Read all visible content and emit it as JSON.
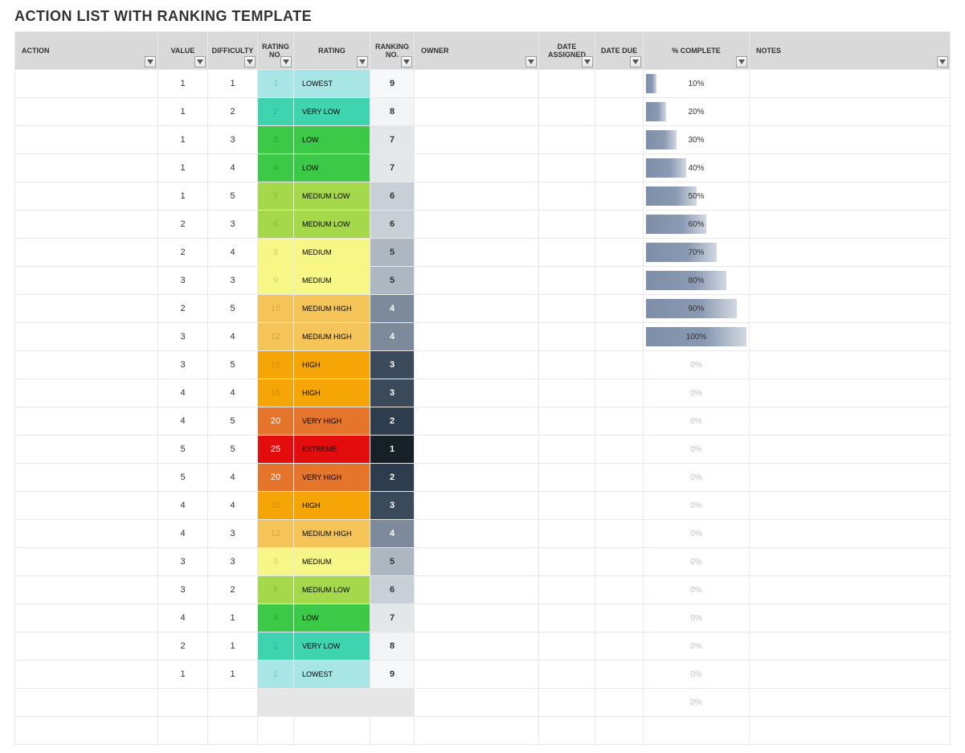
{
  "title": "ACTION LIST WITH RANKING TEMPLATE",
  "columns": {
    "action": "ACTION",
    "value": "VALUE",
    "difficulty": "DIFFICULTY",
    "rating_no": "RATING NO.",
    "rating": "RATING",
    "ranking_no": "RANKING NO.",
    "owner": "OWNER",
    "date_assigned": "DATE ASSIGNED",
    "date_due": "DATE DUE",
    "complete": "% COMPLETE",
    "notes": "NOTES"
  },
  "rows": [
    {
      "value": 1,
      "difficulty": 1,
      "rating_no": 1,
      "rating": "LOWEST",
      "rank_no": 9,
      "rating_no_bg": "#a8e5e5",
      "rating_no_fg": "#7ec9c9",
      "rating_bg": "#a8e5e5",
      "rank_bg": "#f7f8f9",
      "rank_fg": "#333",
      "complete": 10
    },
    {
      "value": 1,
      "difficulty": 2,
      "rating_no": 2,
      "rating": "VERY LOW",
      "rank_no": 8,
      "rating_no_bg": "#3fd4b0",
      "rating_no_fg": "#2cb597",
      "rating_bg": "#3fd4b0",
      "rank_bg": "#f3f4f6",
      "rank_fg": "#333",
      "complete": 20
    },
    {
      "value": 1,
      "difficulty": 3,
      "rating_no": 3,
      "rating": "LOW",
      "rank_no": 7,
      "rating_no_bg": "#3cc948",
      "rating_no_fg": "#2aa835",
      "rating_bg": "#3cc948",
      "rank_bg": "#e4e7ea",
      "rank_fg": "#333",
      "complete": 30
    },
    {
      "value": 1,
      "difficulty": 4,
      "rating_no": 4,
      "rating": "LOW",
      "rank_no": 7,
      "rating_no_bg": "#3cc948",
      "rating_no_fg": "#2aa835",
      "rating_bg": "#3cc948",
      "rank_bg": "#e4e7ea",
      "rank_fg": "#333",
      "complete": 40
    },
    {
      "value": 1,
      "difficulty": 5,
      "rating_no": 5,
      "rating": "MEDIUM LOW",
      "rank_no": 6,
      "rating_no_bg": "#a5d84a",
      "rating_no_fg": "#8abf33",
      "rating_bg": "#a5d84a",
      "rank_bg": "#c9cfd6",
      "rank_fg": "#333",
      "complete": 50
    },
    {
      "value": 2,
      "difficulty": 3,
      "rating_no": 6,
      "rating": "MEDIUM LOW",
      "rank_no": 6,
      "rating_no_bg": "#a5d84a",
      "rating_no_fg": "#8abf33",
      "rating_bg": "#a5d84a",
      "rank_bg": "#c9cfd6",
      "rank_fg": "#333",
      "complete": 60
    },
    {
      "value": 2,
      "difficulty": 4,
      "rating_no": 8,
      "rating": "MEDIUM",
      "rank_no": 5,
      "rating_no_bg": "#f6f787",
      "rating_no_fg": "#d2d36f",
      "rating_bg": "#f6f787",
      "rank_bg": "#aeb7c1",
      "rank_fg": "#333",
      "complete": 70
    },
    {
      "value": 3,
      "difficulty": 3,
      "rating_no": 9,
      "rating": "MEDIUM",
      "rank_no": 5,
      "rating_no_bg": "#f6f787",
      "rating_no_fg": "#d2d36f",
      "rating_bg": "#f6f787",
      "rank_bg": "#aeb7c1",
      "rank_fg": "#333",
      "complete": 80
    },
    {
      "value": 2,
      "difficulty": 5,
      "rating_no": 10,
      "rating": "MEDIUM HIGH",
      "rank_no": 4,
      "rating_no_bg": "#f5c559",
      "rating_no_fg": "#d6a840",
      "rating_bg": "#f5c559",
      "rank_bg": "#7c8a9b",
      "rank_fg": "#fff",
      "complete": 90
    },
    {
      "value": 3,
      "difficulty": 4,
      "rating_no": 12,
      "rating": "MEDIUM HIGH",
      "rank_no": 4,
      "rating_no_bg": "#f5c559",
      "rating_no_fg": "#d6a840",
      "rating_bg": "#f5c559",
      "rank_bg": "#7c8a9b",
      "rank_fg": "#fff",
      "complete": 100
    },
    {
      "value": 3,
      "difficulty": 5,
      "rating_no": 15,
      "rating": "HIGH",
      "rank_no": 3,
      "rating_no_bg": "#f5a506",
      "rating_no_fg": "#d68e04",
      "rating_bg": "#f5a506",
      "rank_bg": "#3a4a5a",
      "rank_fg": "#fff",
      "complete": 0
    },
    {
      "value": 4,
      "difficulty": 4,
      "rating_no": 16,
      "rating": "HIGH",
      "rank_no": 3,
      "rating_no_bg": "#f5a506",
      "rating_no_fg": "#d68e04",
      "rating_bg": "#f5a506",
      "rank_bg": "#3a4a5a",
      "rank_fg": "#fff",
      "complete": 0
    },
    {
      "value": 4,
      "difficulty": 5,
      "rating_no": 20,
      "rating": "VERY HIGH",
      "rank_no": 2,
      "rating_no_bg": "#e6752c",
      "rating_no_fg": "#ffffff",
      "rating_bg": "#e6752c",
      "rank_bg": "#2e3d4d",
      "rank_fg": "#fff",
      "complete": 0
    },
    {
      "value": 5,
      "difficulty": 5,
      "rating_no": 25,
      "rating": "EXTREME",
      "rank_no": 1,
      "rating_no_bg": "#e30d0d",
      "rating_no_fg": "#ffffff",
      "rating_bg": "#e30d0d",
      "rank_bg": "#171f27",
      "rank_fg": "#fff",
      "complete": 0
    },
    {
      "value": 5,
      "difficulty": 4,
      "rating_no": 20,
      "rating": "VERY HIGH",
      "rank_no": 2,
      "rating_no_bg": "#e6752c",
      "rating_no_fg": "#ffffff",
      "rating_bg": "#e6752c",
      "rank_bg": "#2e3d4d",
      "rank_fg": "#fff",
      "complete": 0
    },
    {
      "value": 4,
      "difficulty": 4,
      "rating_no": 16,
      "rating": "HIGH",
      "rank_no": 3,
      "rating_no_bg": "#f5a506",
      "rating_no_fg": "#d68e04",
      "rating_bg": "#f5a506",
      "rank_bg": "#3a4a5a",
      "rank_fg": "#fff",
      "complete": 0
    },
    {
      "value": 4,
      "difficulty": 3,
      "rating_no": 12,
      "rating": "MEDIUM HIGH",
      "rank_no": 4,
      "rating_no_bg": "#f5c559",
      "rating_no_fg": "#d6a840",
      "rating_bg": "#f5c559",
      "rank_bg": "#7c8a9b",
      "rank_fg": "#fff",
      "complete": 0
    },
    {
      "value": 3,
      "difficulty": 3,
      "rating_no": 9,
      "rating": "MEDIUM",
      "rank_no": 5,
      "rating_no_bg": "#f6f787",
      "rating_no_fg": "#d2d36f",
      "rating_bg": "#f6f787",
      "rank_bg": "#aeb7c1",
      "rank_fg": "#333",
      "complete": 0
    },
    {
      "value": 3,
      "difficulty": 2,
      "rating_no": 6,
      "rating": "MEDIUM LOW",
      "rank_no": 6,
      "rating_no_bg": "#a5d84a",
      "rating_no_fg": "#8abf33",
      "rating_bg": "#a5d84a",
      "rank_bg": "#c9cfd6",
      "rank_fg": "#333",
      "complete": 0
    },
    {
      "value": 4,
      "difficulty": 1,
      "rating_no": 4,
      "rating": "LOW",
      "rank_no": 7,
      "rating_no_bg": "#3cc948",
      "rating_no_fg": "#2aa835",
      "rating_bg": "#3cc948",
      "rank_bg": "#e4e7ea",
      "rank_fg": "#333",
      "complete": 0
    },
    {
      "value": 2,
      "difficulty": 1,
      "rating_no": 2,
      "rating": "VERY LOW",
      "rank_no": 8,
      "rating_no_bg": "#3fd4b0",
      "rating_no_fg": "#2cb597",
      "rating_bg": "#3fd4b0",
      "rank_bg": "#f3f4f6",
      "rank_fg": "#333",
      "complete": 0
    },
    {
      "value": 1,
      "difficulty": 1,
      "rating_no": 1,
      "rating": "LOWEST",
      "rank_no": 9,
      "rating_no_bg": "#a8e5e5",
      "rating_no_fg": "#7ec9c9",
      "rating_bg": "#a8e5e5",
      "rank_bg": "#f7f8f9",
      "rank_fg": "#333",
      "complete": 0
    },
    {
      "value": "",
      "difficulty": "",
      "rating_no": "",
      "rating": "",
      "rank_no": "",
      "rating_no_bg": "#e6e6e6",
      "rating_no_fg": "#e6e6e6",
      "rating_bg": "#e6e6e6",
      "rank_bg": "#e6e6e6",
      "rank_fg": "#333",
      "complete": 0,
      "empty": true
    },
    {
      "value": "",
      "difficulty": "",
      "rating_no": "",
      "rating": "",
      "rank_no": "",
      "rating_no_bg": "#ffffff",
      "rating_no_fg": "#ffffff",
      "rating_bg": "#ffffff",
      "rank_bg": "#ffffff",
      "rank_fg": "#333",
      "complete": "",
      "empty": true,
      "partial": true
    }
  ]
}
